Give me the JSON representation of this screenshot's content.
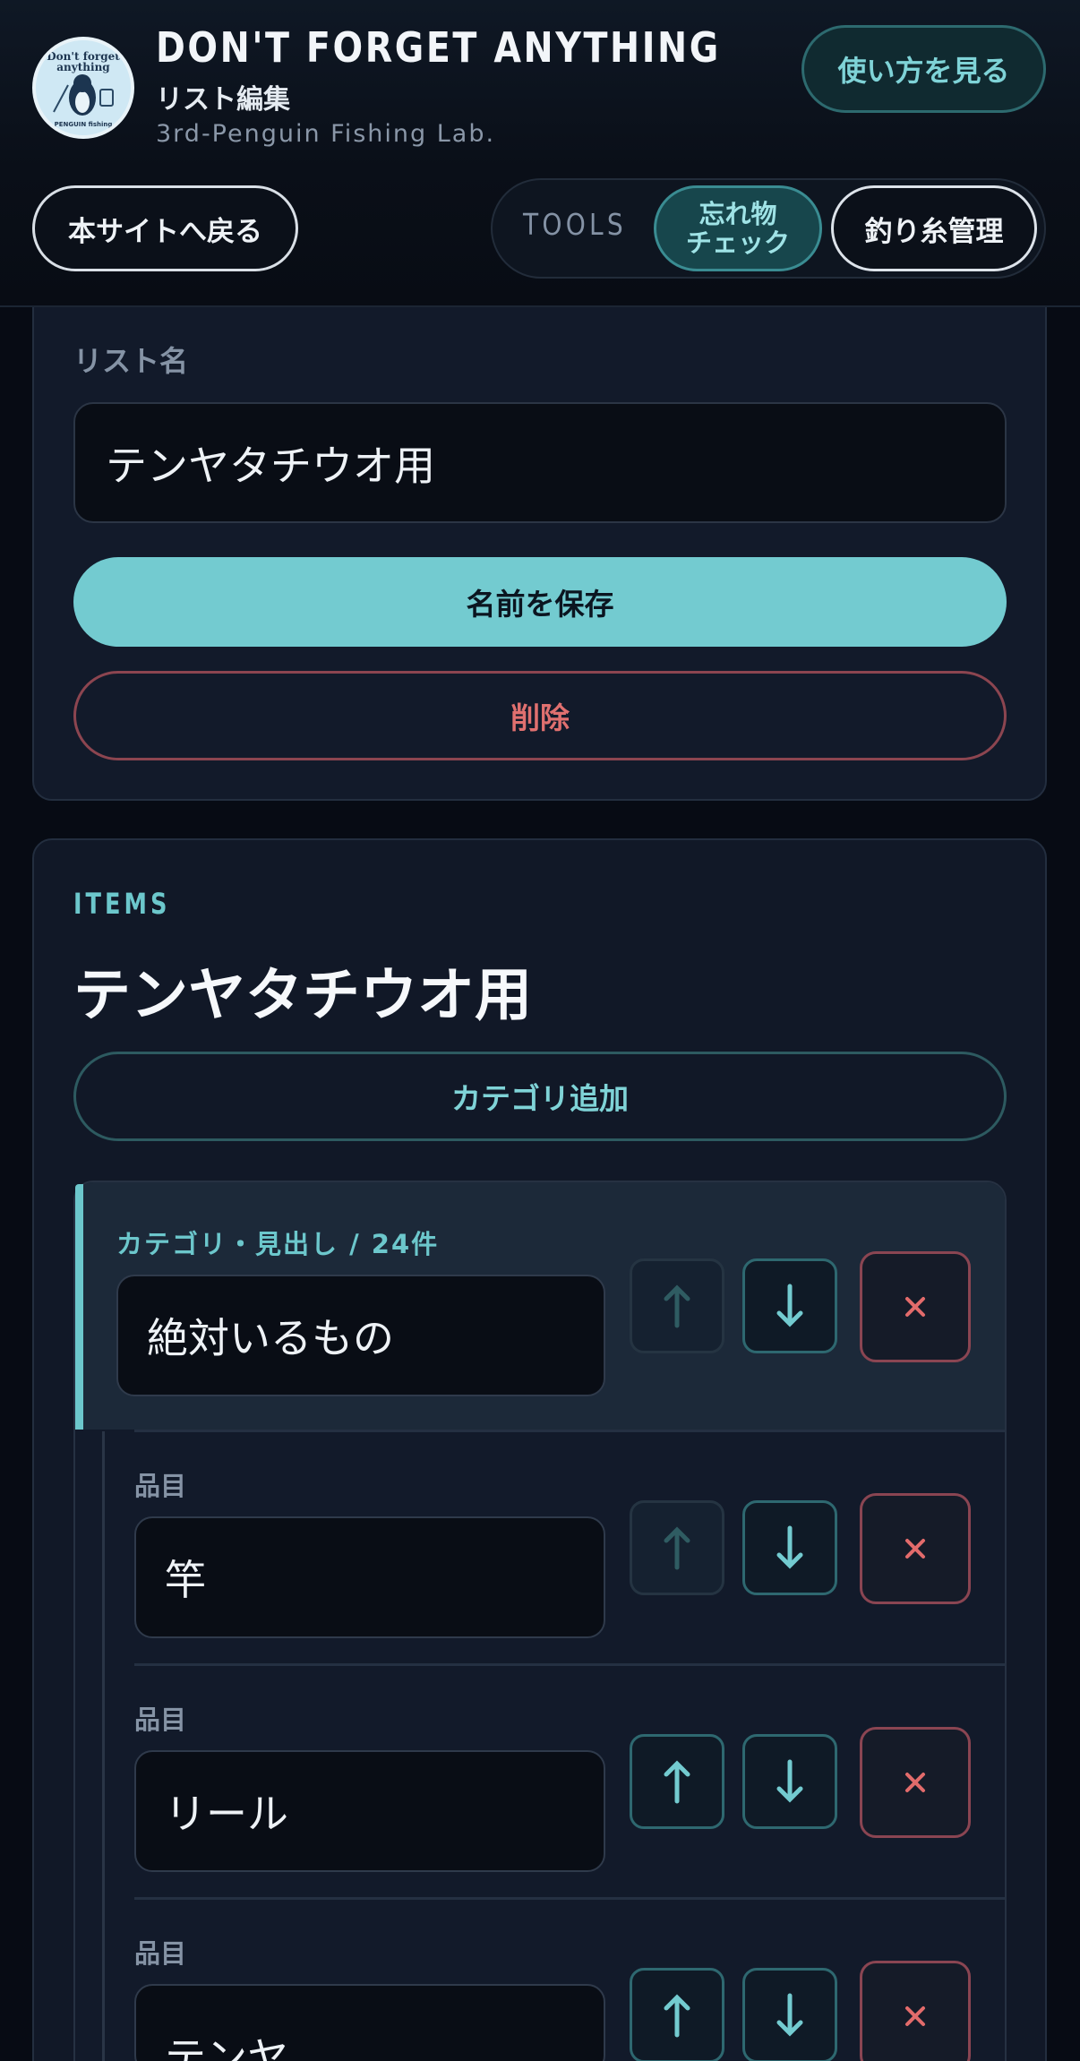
{
  "header": {
    "title": "DON'T FORGET ANYTHING",
    "subtitle": "リスト編集",
    "lab": "3rd-Penguin Fishing Lab.",
    "logo_text_top": "Don't forget anything",
    "logo_text_bottom": "PENGUIN fishing",
    "howto_label": "使い方を見る",
    "back_label": "本サイトへ戻る",
    "tools_label": "TOOLS",
    "tool_forget_line1": "忘れ物",
    "tool_forget_line2": "チェック",
    "tool_line_label": "釣り糸管理"
  },
  "list_settings": {
    "field_label": "リスト名",
    "name_value": "テンヤタチウオ用",
    "save_label": "名前を保存",
    "delete_label": "削除"
  },
  "items_section": {
    "section_label": "ITEMS",
    "title": "テンヤタチウオ用",
    "add_category_label": "カテゴリ追加",
    "category": {
      "label": "カテゴリ・見出し / 24件",
      "value": "絶対いるもの",
      "up_enabled": false
    },
    "items": [
      {
        "label": "品目",
        "value": "竿",
        "up_enabled": false
      },
      {
        "label": "品目",
        "value": "リール",
        "up_enabled": true
      },
      {
        "label": "品目",
        "value": "テンヤ",
        "up_enabled": true
      }
    ]
  },
  "colors": {
    "accent": "#73cbd0",
    "danger": "#e0706f",
    "background": "#070b14",
    "card": "#121a2a"
  },
  "icons": {
    "up": "arrow-up-icon",
    "down": "arrow-down-icon",
    "delete": "close-icon"
  }
}
